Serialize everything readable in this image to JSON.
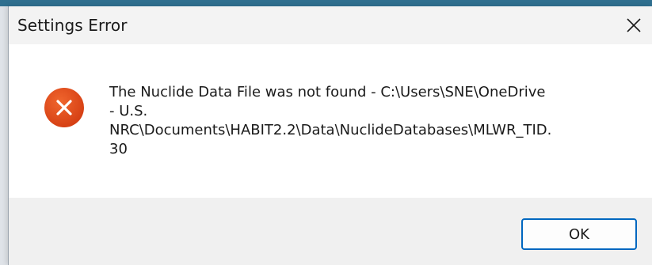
{
  "dialog": {
    "title": "Settings Error",
    "close_icon": "close-icon",
    "error_icon": "error-x-circle-icon",
    "message": "The Nuclide Data File was not found - C:\\Users\\SNE\\OneDrive\n- U.S.\nNRC\\Documents\\HABIT2.2\\Data\\NuclideDatabases\\MLWR_TID.\n30",
    "ok_label": "OK"
  },
  "colors": {
    "error_icon": "#e24a1c",
    "focus_border": "#0067c0",
    "footer_bg": "#f0f0f0",
    "titlebar_bg": "#f3f3f3"
  }
}
